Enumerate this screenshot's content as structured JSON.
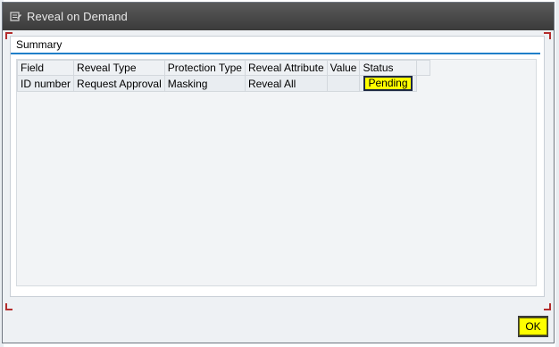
{
  "window": {
    "title": "Reveal on Demand"
  },
  "panel": {
    "title": "Summary"
  },
  "table": {
    "columns": [
      "Field",
      "Reveal Type",
      "Protection Type",
      "Reveal Attribute",
      "Value",
      "Status"
    ],
    "rows": [
      {
        "field": "ID number",
        "reveal_type": "Request Approval",
        "protection_type": "Masking",
        "reveal_attribute": "Reveal All",
        "value": "",
        "status": "Pending"
      }
    ]
  },
  "buttons": {
    "ok_label": "OK"
  },
  "colors": {
    "highlight": "#ffff00",
    "titlebar": "#4a4a4a",
    "accent_line": "#1f7fc9"
  },
  "icons": {
    "title_icon": "dialog-edit-icon"
  }
}
